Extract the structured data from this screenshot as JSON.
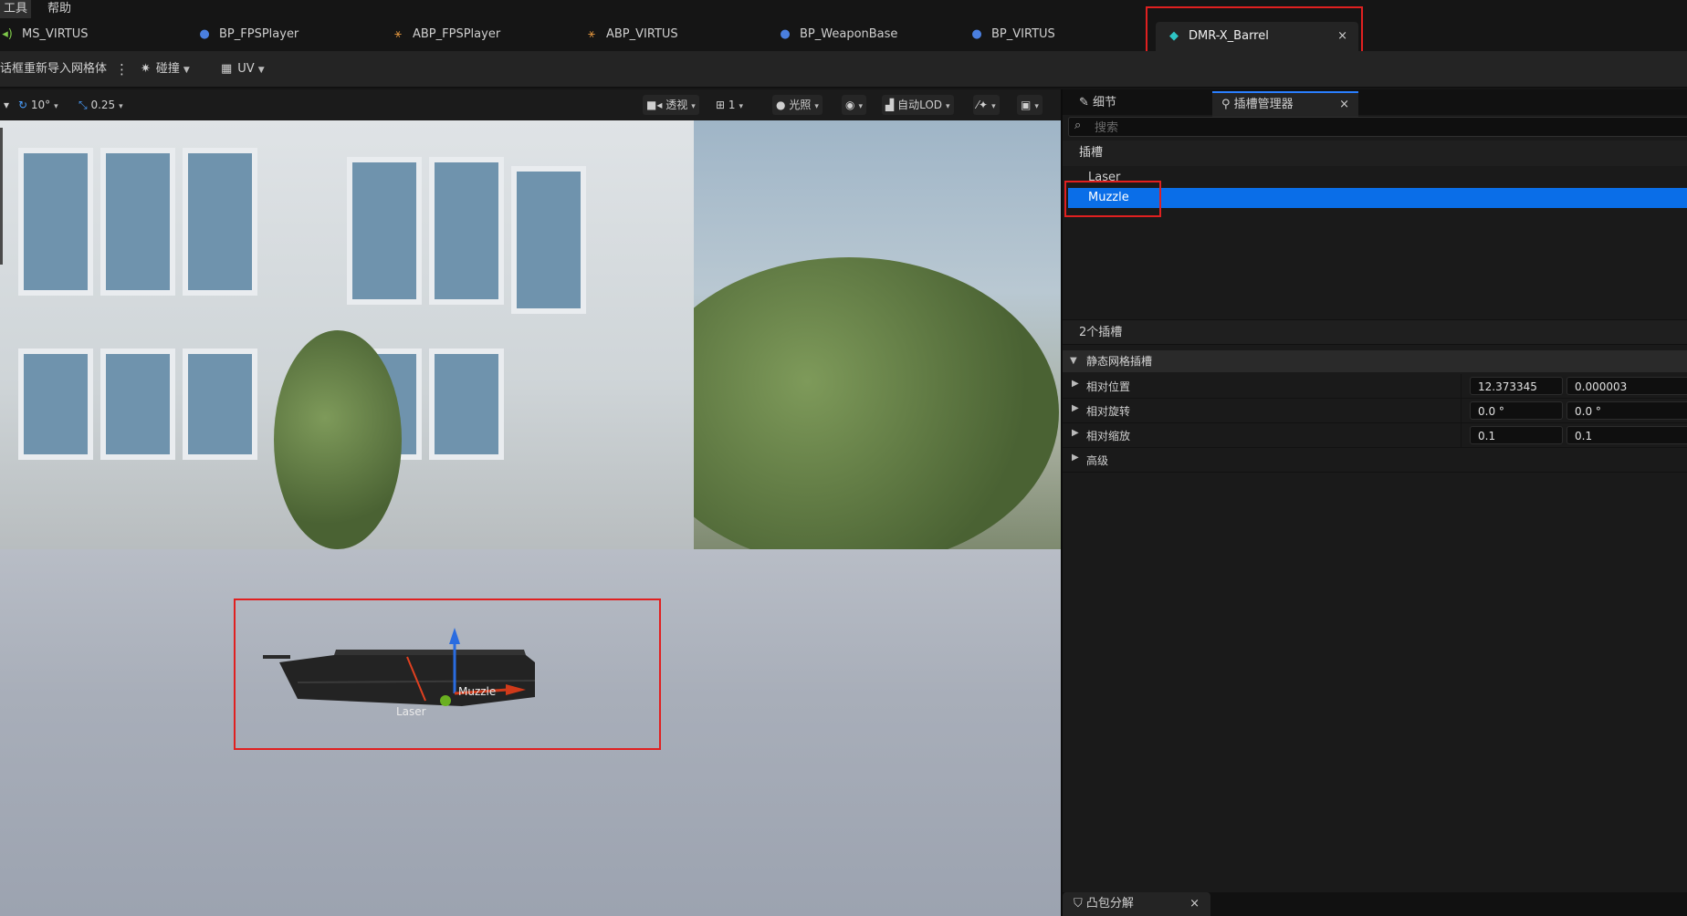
{
  "menu": {
    "items": [
      "工具",
      "帮助"
    ]
  },
  "tabs": [
    {
      "label": "MS_VIRTUS",
      "icon": "sound-wave-icon",
      "color": "#7ec84a"
    },
    {
      "label": "BP_FPSPlayer",
      "icon": "blueprint-person-icon",
      "color": "#4a7fe0"
    },
    {
      "label": "ABP_FPSPlayer",
      "icon": "anim-blueprint-icon",
      "color": "#d08a3a"
    },
    {
      "label": "ABP_VIRTUS",
      "icon": "anim-blueprint-icon",
      "color": "#d08a3a"
    },
    {
      "label": "BP_WeaponBase",
      "icon": "blueprint-person-icon",
      "color": "#4a7fe0"
    },
    {
      "label": "BP_VIRTUS",
      "icon": "blueprint-person-icon",
      "color": "#4a7fe0"
    }
  ],
  "active_tab": {
    "label": "DMR-X_Barrel",
    "icon": "static-mesh-icon",
    "color": "#2ec4c4",
    "close": "×"
  },
  "toolbar": {
    "reimport_label": "话框重新导入网格体",
    "more": "⋮",
    "collision_label": "碰撞",
    "uv_label": "UV"
  },
  "viewport_toolbar": {
    "rotation_snap": "10°",
    "scale_snap": "0.25",
    "perspective": "透视",
    "camera_speed": "1",
    "lighting": "光照",
    "lod": "自动LOD"
  },
  "viewport": {
    "socket_labels": [
      "Muzzle",
      "Laser"
    ]
  },
  "panel": {
    "tabs": {
      "details": "细节",
      "socket_manager": "插槽管理器",
      "close": "×"
    },
    "search_placeholder": "搜索",
    "socket_header": "插槽",
    "sockets": [
      "Laser",
      "Muzzle"
    ],
    "selected_socket": "Muzzle",
    "socket_count": "2个插槽",
    "section_title": "静态网格插槽",
    "properties": [
      {
        "label": "相对位置",
        "x": "12.373345",
        "y": "0.000003"
      },
      {
        "label": "相对旋转",
        "x": "0.0 °",
        "y": "0.0 °"
      },
      {
        "label": "相对缩放",
        "x": "0.1",
        "y": "0.1"
      },
      {
        "label": "高级"
      }
    ],
    "bottom_tab": {
      "label": "凸包分解",
      "close": "×"
    }
  }
}
